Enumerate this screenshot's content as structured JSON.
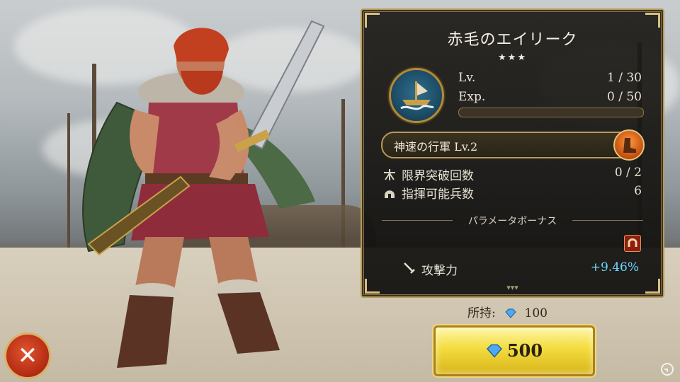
{
  "hero": {
    "name": "赤毛のエイリーク",
    "stars": "★★★",
    "level_label": "Lv.",
    "level_value": "1 / 30",
    "exp_label": "Exp.",
    "exp_value": "0 / 50",
    "exp_progress": 0
  },
  "skill": {
    "label": "神速の行軍 Lv.2",
    "icon": "boot-icon"
  },
  "stats": [
    {
      "icon": "limit-break-icon",
      "label": "限界突破回数",
      "value": "0 / 2"
    },
    {
      "icon": "helmet-icon",
      "label": "指揮可能兵数",
      "value": "6"
    }
  ],
  "bonus": {
    "section_title": "パラメータボーナス",
    "label": "攻撃力",
    "value": "+9.46%",
    "icon": "sword-icon"
  },
  "owned": {
    "label": "所持:",
    "value": "100"
  },
  "buy": {
    "price": "500"
  },
  "colors": {
    "panel_border": "#b79a5a",
    "bonus_value": "#6fd7ff",
    "buy_button": "#f3dc3e",
    "close_button": "#c0341a"
  }
}
